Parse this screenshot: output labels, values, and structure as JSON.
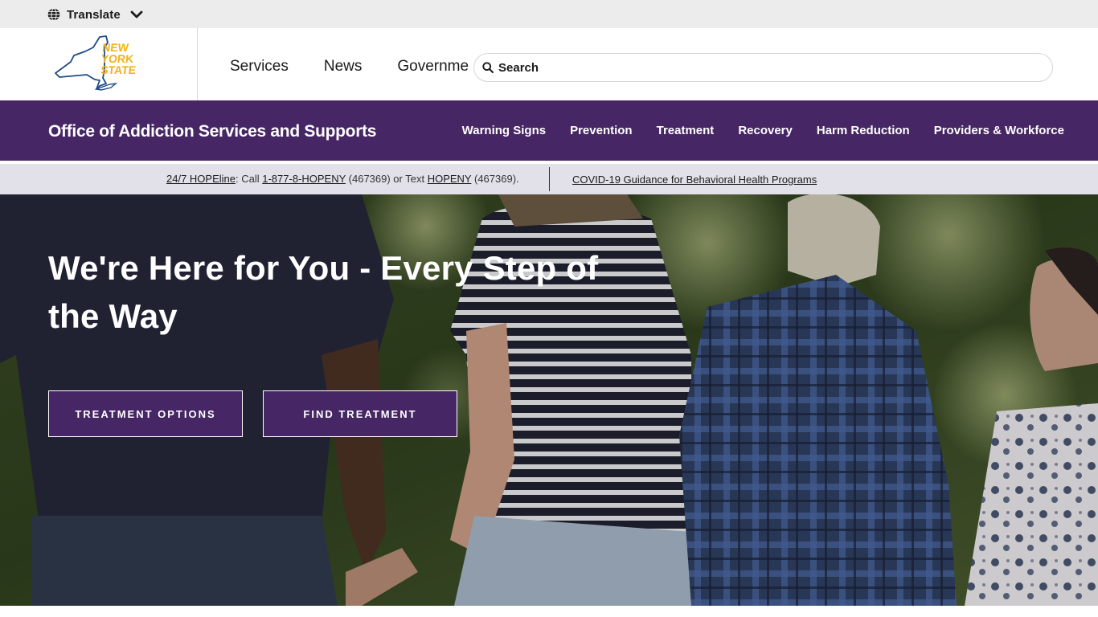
{
  "translate": {
    "label": "Translate",
    "icon": "globe-icon",
    "chevron": "chevron-down-icon"
  },
  "nys_header": {
    "logo_lines": [
      "NEW",
      "YORK",
      "STATE"
    ],
    "nav": [
      "Services",
      "News",
      "Government"
    ],
    "search_placeholder": "Search"
  },
  "agency": {
    "name": "Office of Addiction Services and Supports",
    "nav": [
      "Warning Signs",
      "Prevention",
      "Treatment",
      "Recovery",
      "Harm Reduction",
      "Providers & Workforce"
    ]
  },
  "alert": {
    "hopeline_link": "24/7 HOPEline",
    "call_text": ": Call ",
    "phone_link": "1-877-8-HOPENY",
    "phone_digits": " (467369) or Text ",
    "text_link": "HOPENY",
    "text_digits": " (467369).",
    "covid_link": "COVID-19 Guidance for Behavioral Health Programs"
  },
  "hero": {
    "title": "We're Here for You - Every Step of the Way",
    "buttons": [
      "TREATMENT OPTIONS",
      "FIND TREATMENT"
    ]
  },
  "colors": {
    "brand_purple": "#462664",
    "nys_gold": "#f2b21b",
    "nys_blue": "#1e4b87",
    "alert_bg": "#e2e1ea",
    "translate_bg": "#ececec"
  }
}
